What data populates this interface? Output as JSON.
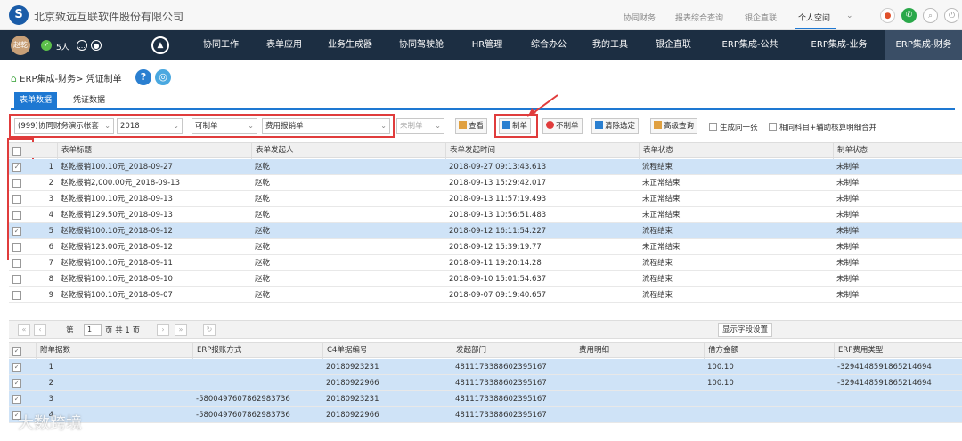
{
  "top": {
    "company": "北京致远互联软件股份有限公司",
    "links": [
      "协同财务",
      "报表综合查询",
      "银企直联",
      "个人空间"
    ],
    "active_link": "个人空间"
  },
  "nav": {
    "avatar": "赵乾",
    "online": "5人",
    "items": [
      "协同工作",
      "表单应用",
      "业务生成器",
      "协同驾驶舱",
      "HR管理",
      "综合办公",
      "我的工具",
      "银企直联",
      "ERP集成-公共",
      "ERP集成-业务",
      "ERP集成-财务"
    ],
    "active": "ERP集成-财务"
  },
  "breadcrumb": "ERP集成-财务> 凭证制单",
  "tabs": [
    "表单数据",
    "凭证数据"
  ],
  "toolbar": {
    "account_set": "(999)协同财务演示帐套",
    "year": "2018",
    "status": "可制单",
    "form": "费用报销单",
    "unmade": "未制单",
    "view": "查看",
    "make": "制单",
    "unmake": "不制单",
    "clear": "清除选定",
    "adv": "高级查询",
    "gen_one": "生成同一张",
    "same_subject": "相同科目+辅助核算明细合并"
  },
  "grid1": {
    "headers": [
      "表单标题",
      "表单发起人",
      "表单发起时间",
      "表单状态",
      "制单状态"
    ],
    "rows": [
      {
        "n": "1",
        "title": "赵乾报销100.10元_2018-09-27",
        "user": "赵乾",
        "time": "2018-09-27 09:13:43.613",
        "state": "流程结束",
        "make": "未制单",
        "checked": true
      },
      {
        "n": "2",
        "title": "赵乾报销2,000.00元_2018-09-13",
        "user": "赵乾",
        "time": "2018-09-13 15:29:42.017",
        "state": "未正常结束",
        "make": "未制单",
        "checked": false
      },
      {
        "n": "3",
        "title": "赵乾报销100.10元_2018-09-13",
        "user": "赵乾",
        "time": "2018-09-13 11:57:19.493",
        "state": "未正常结束",
        "make": "未制单",
        "checked": false
      },
      {
        "n": "4",
        "title": "赵乾报销129.50元_2018-09-13",
        "user": "赵乾",
        "time": "2018-09-13 10:56:51.483",
        "state": "未正常结束",
        "make": "未制单",
        "checked": false
      },
      {
        "n": "5",
        "title": "赵乾报销100.10元_2018-09-12",
        "user": "赵乾",
        "time": "2018-09-12 16:11:54.227",
        "state": "流程结束",
        "make": "未制单",
        "checked": true
      },
      {
        "n": "6",
        "title": "赵乾报销123.00元_2018-09-12",
        "user": "赵乾",
        "time": "2018-09-12 15:39:19.77",
        "state": "未正常结束",
        "make": "未制单",
        "checked": false
      },
      {
        "n": "7",
        "title": "赵乾报销100.10元_2018-09-11",
        "user": "赵乾",
        "time": "2018-09-11 19:20:14.28",
        "state": "流程结束",
        "make": "未制单",
        "checked": false
      },
      {
        "n": "8",
        "title": "赵乾报销100.10元_2018-09-10",
        "user": "赵乾",
        "time": "2018-09-10 15:01:54.637",
        "state": "流程结束",
        "make": "未制单",
        "checked": false
      },
      {
        "n": "9",
        "title": "赵乾报销100.10元_2018-09-07",
        "user": "赵乾",
        "time": "2018-09-07 09:19:40.657",
        "state": "流程结束",
        "make": "未制单",
        "checked": false
      }
    ]
  },
  "pager": {
    "page_label": "第",
    "page": "1",
    "total": "页 共 1 页",
    "field_btn": "显示字段设置"
  },
  "grid2": {
    "headers": [
      "附单据数",
      "ERP报账方式",
      "C4单据编号",
      "发起部门",
      "费用明细",
      "借方金额",
      "ERP费用类型"
    ],
    "rows": [
      {
        "n": "1",
        "erp": "",
        "c4": "20180923231",
        "dept": "4811173388602395167",
        "detail": "",
        "debit": "100.10",
        "type": "-3294148591865214694"
      },
      {
        "n": "2",
        "erp": "",
        "c4": "20180922966",
        "dept": "4811173388602395167",
        "detail": "",
        "debit": "100.10",
        "type": "-3294148591865214694"
      },
      {
        "n": "3",
        "erp": "-5800497607862983736",
        "c4": "20180923231",
        "dept": "4811173388602395167",
        "detail": "",
        "debit": "",
        "type": ""
      },
      {
        "n": "4",
        "erp": "-5800497607862983736",
        "c4": "20180922966",
        "dept": "4811173388602395167",
        "detail": "",
        "debit": "",
        "type": ""
      }
    ]
  },
  "watermark": "大数跨境"
}
